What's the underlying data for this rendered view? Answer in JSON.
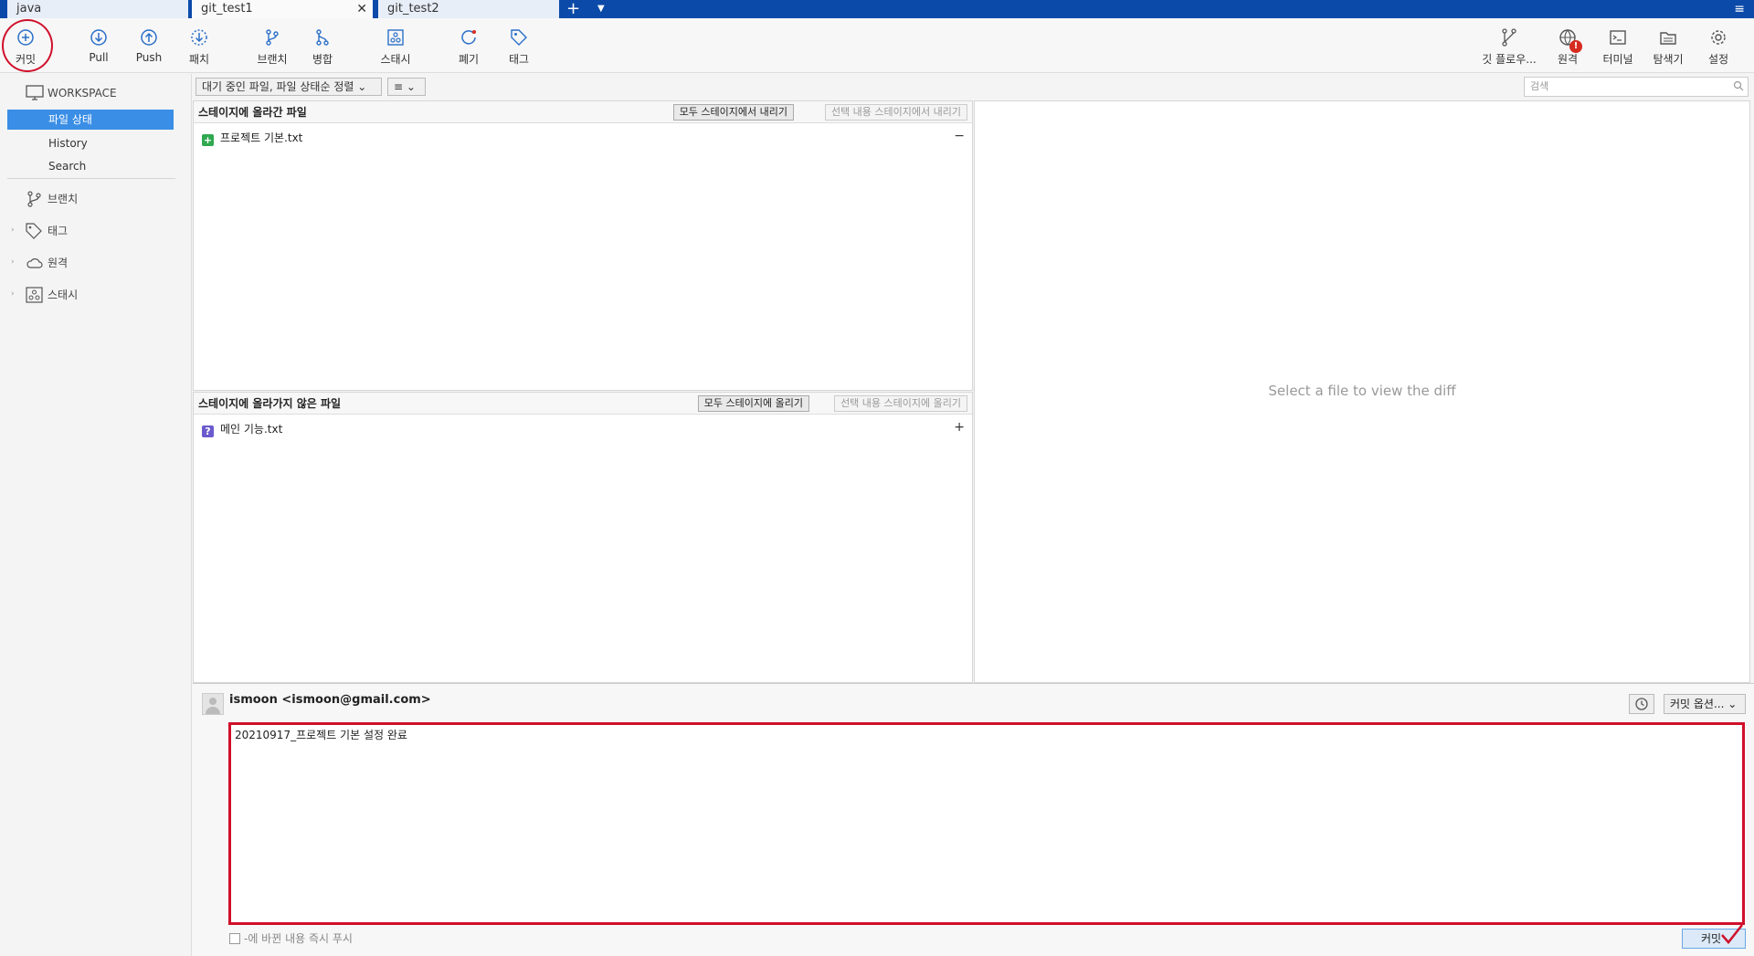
{
  "tabs": [
    {
      "label": "java",
      "active": false
    },
    {
      "label": "git_test1",
      "active": true
    },
    {
      "label": "git_test2",
      "active": false
    }
  ],
  "toolbar": {
    "commit": "커밋",
    "pull": "Pull",
    "push": "Push",
    "fetch": "패치",
    "branch": "브랜치",
    "merge": "병합",
    "stash": "스태시",
    "discard": "폐기",
    "tag": "태그",
    "gitflow": "깃 플로우...",
    "remote": "원격",
    "remote_badge": "!",
    "terminal": "터미널",
    "explorer": "탐색기",
    "settings": "설정"
  },
  "sidebar": {
    "workspace": "WORKSPACE",
    "file_status": "파일 상태",
    "history": "History",
    "search": "Search",
    "branches": "브랜치",
    "tags": "태그",
    "remotes": "원격",
    "stashes": "스태시"
  },
  "filter": {
    "sort": "대기 중인 파일, 파일 상태순 정렬",
    "list_mode": "≡"
  },
  "search": {
    "placeholder": "검색"
  },
  "staged": {
    "title": "스테이지에 올라간 파일",
    "unstage_all": "모두 스테이지에서 내리기",
    "unstage_selected": "선택 내용 스테이지에서 내리기",
    "files": [
      {
        "name": "프로젝트 기본.txt",
        "status": "added"
      }
    ]
  },
  "unstaged": {
    "title": "스테이지에 올라가지 않은 파일",
    "stage_all": "모두 스테이지에 올리기",
    "stage_selected": "선택 내용 스테이지에 올리기",
    "files": [
      {
        "name": "메인 기능.txt",
        "status": "untracked"
      }
    ]
  },
  "diff": {
    "placeholder": "Select a file to view the diff"
  },
  "commit": {
    "author": "ismoon <ismoon@gmail.com>",
    "message": "20210917_프로젝트 기본 설정 완료",
    "options": "커밋 옵션...",
    "push_immediately": "-에 바뀐 내용 즉시 푸시",
    "button": "커밋"
  },
  "colors": {
    "accent": "#3a8ee6",
    "tabbar": "#0b4aa8",
    "annotation": "#d0102a",
    "added": "#2fa84f",
    "untracked": "#6a5acd"
  }
}
